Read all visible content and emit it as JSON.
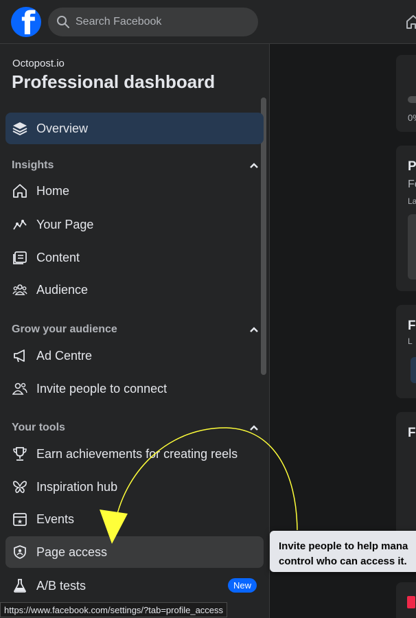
{
  "topbar": {
    "logo_letter": "f",
    "search_placeholder": "Search Facebook"
  },
  "sidebar": {
    "brand": "Octopost.io",
    "title": "Professional dashboard",
    "overview": "Overview",
    "sections": {
      "insights": "Insights",
      "grow": "Grow your audience",
      "tools": "Your tools"
    },
    "items": {
      "home": "Home",
      "your_page": "Your Page",
      "content": "Content",
      "audience": "Audience",
      "ad_centre": "Ad Centre",
      "invite": "Invite people to connect",
      "achievements": "Earn achievements for creating reels",
      "inspiration": "Inspiration hub",
      "events": "Events",
      "page_access": "Page access",
      "ab_tests": "A/B tests"
    },
    "new_badge": "New"
  },
  "main": {
    "card1_text": "0%",
    "card2_title": "P",
    "card2_sub": "Fo",
    "card2_small": "La",
    "card3_title": "F",
    "card3_small": "L",
    "card4_title": "F"
  },
  "tooltip": {
    "line1": "Invite people to help mana",
    "line2": "control who can access it."
  },
  "status_url": "https://www.facebook.com/settings/?tab=profile_access",
  "colors": {
    "accent": "#0866ff",
    "selected_bg": "#263951",
    "annotation": "#ffff3a"
  }
}
